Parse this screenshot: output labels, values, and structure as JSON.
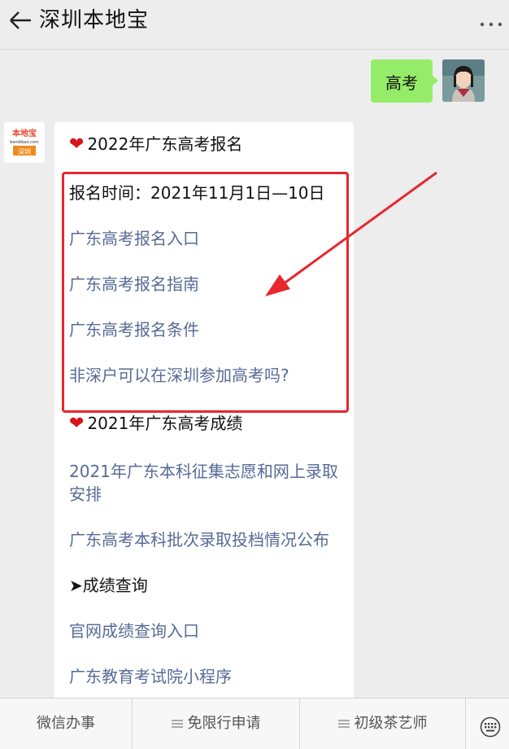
{
  "header": {
    "title": "深圳本地宝"
  },
  "chat": {
    "user_message": "高考",
    "bot_avatar": {
      "logo_text": "本地宝",
      "sub_text": "bendibao.com",
      "city": "深圳"
    },
    "card": {
      "section1_title": "2022年广东高考报名",
      "reg_time": "报名时间：2021年11月1日—10日",
      "links1": [
        "广东高考报名入口",
        "广东高考报名指南",
        "广东高考报名条件",
        "非深户可以在深圳参加高考吗?"
      ],
      "section2_title": "2021年广东高考成绩",
      "links2": [
        "2021年广东本科征集志愿和网上录取安排",
        "广东高考本科批次录取投档情况公布"
      ],
      "score_query": "➤成绩查询",
      "links3": [
        "官网成绩查询入口",
        "广东教育考试院小程序"
      ]
    }
  },
  "bottom_menu": {
    "items": [
      "微信办事",
      "免限行申请",
      "初级茶艺师"
    ]
  },
  "icons": {
    "back": "back-arrow-icon",
    "more": "more-icon",
    "heart": "heart-icon",
    "keyboard": "keyboard-icon"
  },
  "colors": {
    "link": "#576b95",
    "user_bubble": "#95ec69",
    "highlight": "#e8262e"
  }
}
